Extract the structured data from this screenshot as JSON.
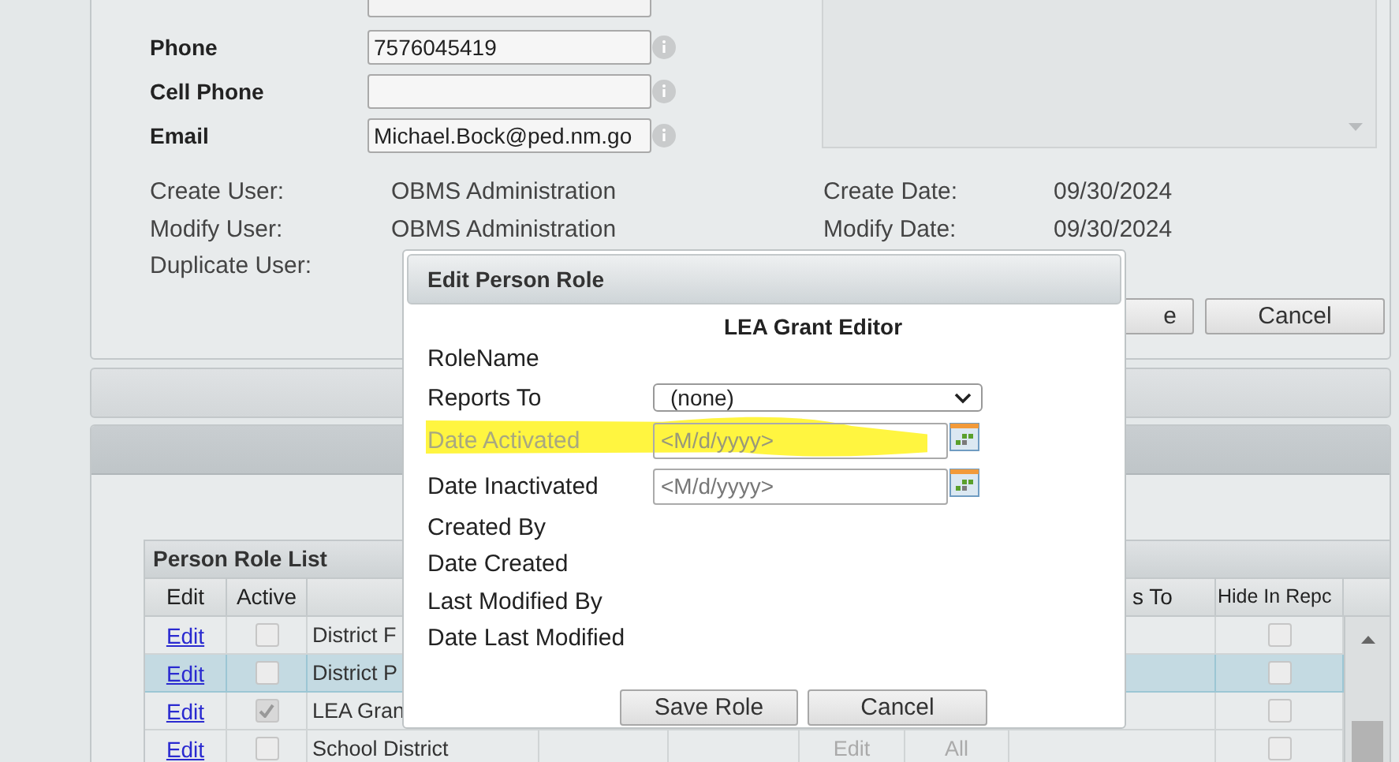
{
  "contact_fields": [
    {
      "label": "Phone",
      "value": "7576045419"
    },
    {
      "label": "Cell Phone"
    },
    {
      "label": "Email",
      "value": "Michael.Bock@ped.nm.go"
    }
  ],
  "audit_rows": [
    {
      "user_label": "Create User:",
      "user_value": "OBMS Administration",
      "date_label": "Create Date:",
      "date_value": "09/30/2024"
    },
    {
      "user_label": "Modify User:",
      "user_value": "OBMS Administration",
      "date_label": "Modify Date:",
      "date_value": "09/30/2024"
    },
    {
      "user_label": "Duplicate User:"
    }
  ],
  "buttons": [
    {
      "label": "e"
    },
    {
      "label": "Cancel"
    }
  ],
  "role_list": {
    "title": "Person Role List",
    "header": {
      "edit": "Edit",
      "active": "Active",
      "column_8": "s To",
      "hide_in_report": "Hide In Repc"
    },
    "rows": [
      {
        "edit": "Edit",
        "active": false,
        "name": "District F",
        "selected": false,
        "hide": false
      },
      {
        "edit": "Edit",
        "active": false,
        "name": "District P",
        "selected": true,
        "hide": false
      },
      {
        "edit": "Edit",
        "active": true,
        "name": "LEA Gran",
        "selected": false,
        "hide": false
      },
      {
        "edit": "Edit",
        "active": false,
        "name": "School District",
        "column_6": "Edit",
        "column_7": "All",
        "selected": false,
        "hide": false
      }
    ]
  },
  "dialog": {
    "title": "Edit Person Role",
    "heading": "LEA Grant Editor",
    "fields": [
      {
        "kind": "text",
        "label": "RoleName"
      },
      {
        "kind": "select",
        "label": "Reports To",
        "value": "(none)"
      },
      {
        "kind": "date",
        "label": "Date Activated",
        "placeholder": "<M/d/yyyy>",
        "disabled": true
      },
      {
        "kind": "date",
        "label": "Date Inactivated",
        "placeholder": "<M/d/yyyy>",
        "disabled": false
      },
      {
        "kind": "text",
        "label": "Created By"
      },
      {
        "kind": "text",
        "label": "Date Created"
      },
      {
        "kind": "text",
        "label": "Last Modified By"
      },
      {
        "kind": "text",
        "label": "Date Last Modified"
      }
    ],
    "buttons": [
      {
        "label": "Save Role"
      },
      {
        "label": "Cancel"
      }
    ]
  }
}
